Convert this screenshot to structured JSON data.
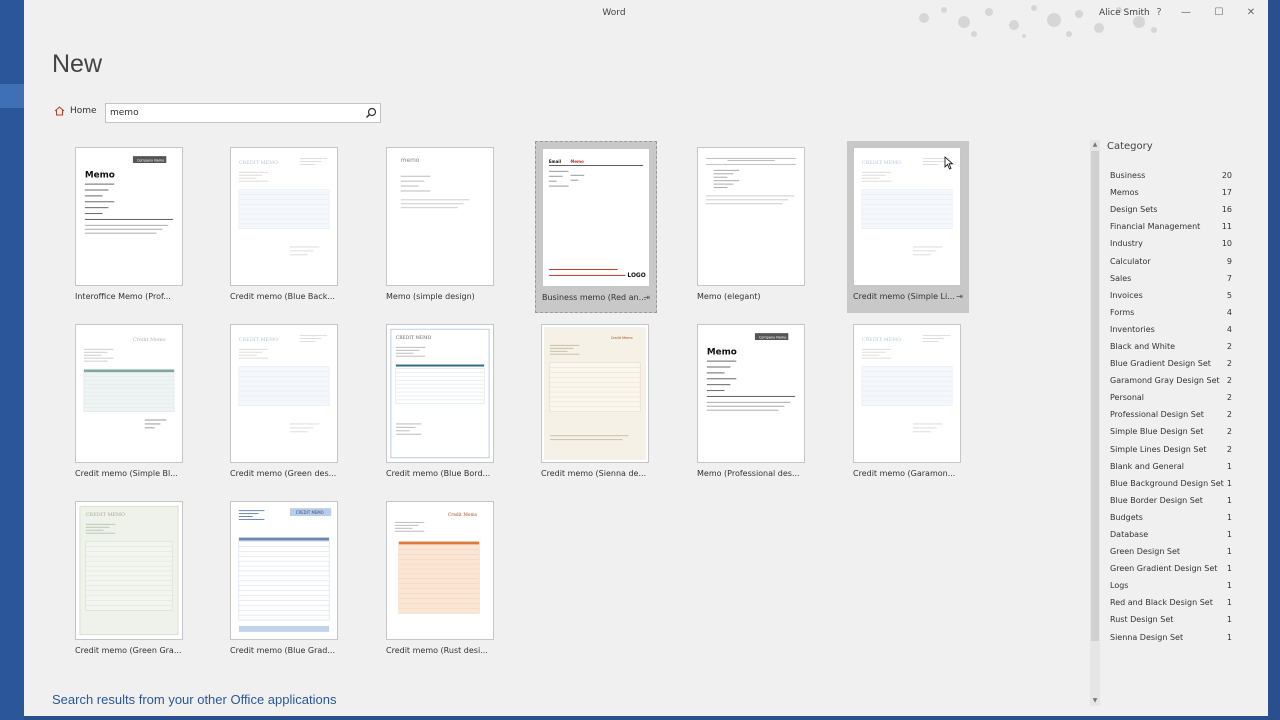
{
  "window": {
    "title": "Word",
    "user": "Alice Smith",
    "help": "?",
    "minimize": "—",
    "restore": "☐",
    "close": "✕"
  },
  "page": {
    "title": "New"
  },
  "nav": {
    "home": "Home"
  },
  "search": {
    "value": "memo"
  },
  "templates": [
    {
      "label": "Interoffice Memo (Prof...",
      "style": "memo-bold"
    },
    {
      "label": "Credit memo (Blue Back...",
      "style": "credit-faint"
    },
    {
      "label": "Memo (simple design)",
      "style": "memo-simple"
    },
    {
      "label": "Business memo (Red an...",
      "style": "memo-red",
      "selected": true,
      "pinned": true
    },
    {
      "label": "Memo (elegant)",
      "style": "memo-elegant"
    },
    {
      "label": "Credit memo (Simple Li...",
      "style": "credit-faint",
      "hovered": true,
      "pinned": true
    },
    {
      "label": "Credit memo (Simple Bl...",
      "style": "credit-blue"
    },
    {
      "label": "Credit memo (Green des...",
      "style": "credit-faint"
    },
    {
      "label": "Credit memo (Blue Bord...",
      "style": "credit-border"
    },
    {
      "label": "Credit memo (Sienna de...",
      "style": "credit-sienna"
    },
    {
      "label": "Memo (Professional des...",
      "style": "memo-bold"
    },
    {
      "label": "Credit memo (Garamon...",
      "style": "credit-faint"
    },
    {
      "label": "Credit memo (Green Gra...",
      "style": "credit-green"
    },
    {
      "label": "Credit memo (Blue Grad...",
      "style": "credit-bluegrad"
    },
    {
      "label": "Credit memo (Rust desi...",
      "style": "credit-rust"
    }
  ],
  "thumbnail_text": {
    "memo_title": "Memo",
    "memo_lower": "memo",
    "company_tag": "Company Name",
    "credit_memo_caps": "CREDIT MEMO",
    "credit_memo": "Credit Memo",
    "logo": "LOGO"
  },
  "category": {
    "header": "Category",
    "items": [
      {
        "name": "Business",
        "count": "20"
      },
      {
        "name": "Memos",
        "count": "17"
      },
      {
        "name": "Design Sets",
        "count": "16"
      },
      {
        "name": "Financial Management",
        "count": "11"
      },
      {
        "name": "Industry",
        "count": "10"
      },
      {
        "name": "Calculator",
        "count": "9"
      },
      {
        "name": "Sales",
        "count": "7"
      },
      {
        "name": "Invoices",
        "count": "5"
      },
      {
        "name": "Forms",
        "count": "4"
      },
      {
        "name": "Inventories",
        "count": "4"
      },
      {
        "name": "Black and White",
        "count": "2"
      },
      {
        "name": "Blue Gradient Design Set",
        "count": "2"
      },
      {
        "name": "Garamond Gray Design Set",
        "count": "2"
      },
      {
        "name": "Personal",
        "count": "2"
      },
      {
        "name": "Professional Design Set",
        "count": "2"
      },
      {
        "name": "Simple Blue Design Set",
        "count": "2"
      },
      {
        "name": "Simple Lines Design Set",
        "count": "2"
      },
      {
        "name": "Blank and General",
        "count": "1"
      },
      {
        "name": "Blue Background Design Set",
        "count": "1"
      },
      {
        "name": "Blue Border Design Set",
        "count": "1"
      },
      {
        "name": "Budgets",
        "count": "1"
      },
      {
        "name": "Database",
        "count": "1"
      },
      {
        "name": "Green Design Set",
        "count": "1"
      },
      {
        "name": "Green Gradient Design Set",
        "count": "1"
      },
      {
        "name": "Logs",
        "count": "1"
      },
      {
        "name": "Red and Black Design Set",
        "count": "1"
      },
      {
        "name": "Rust Design Set",
        "count": "1"
      },
      {
        "name": "Sienna Design Set",
        "count": "1"
      }
    ]
  },
  "footer": {
    "other_results": "Search results from your other Office applications"
  },
  "colors": {
    "accent": "#2b579a",
    "selected_tile": "#c8c8c8",
    "red_memo": "#c0392b",
    "rust": "#e8a070"
  }
}
